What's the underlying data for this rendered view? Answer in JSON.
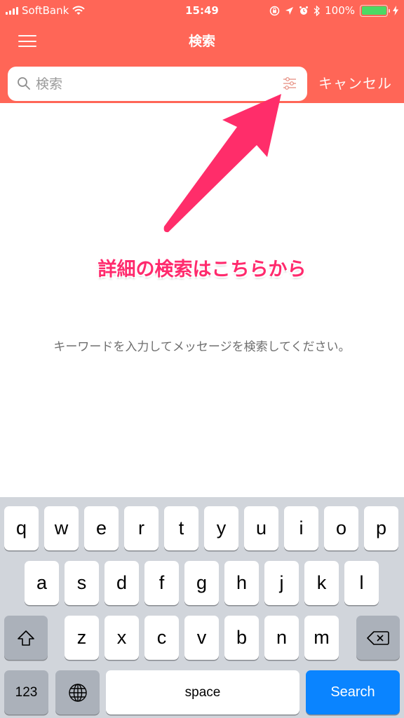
{
  "status_bar": {
    "carrier": "SoftBank",
    "time": "15:49",
    "battery_percent_text": "100%",
    "battery_level": 1.0,
    "icons": [
      "signal-icon",
      "wifi-icon",
      "rotation-lock-icon",
      "location-icon",
      "alarm-icon",
      "bluetooth-icon",
      "battery-icon",
      "charging-icon"
    ]
  },
  "nav": {
    "title": "検索",
    "menu_icon": "hamburger-menu-icon"
  },
  "search": {
    "placeholder": "検索",
    "value": "",
    "filter_icon": "filter-sliders-icon",
    "cancel_label": "キャンセル"
  },
  "annotation": {
    "text": "詳細の検索はこちらから",
    "color": "#ff2a6d"
  },
  "hint_text": "キーワードを入力してメッセージを検索してください。",
  "colors": {
    "header": "#ff6657",
    "keyboard_bg": "#d1d5db",
    "search_key": "#0a84ff"
  },
  "keyboard": {
    "row1": [
      "q",
      "w",
      "e",
      "r",
      "t",
      "y",
      "u",
      "i",
      "o",
      "p"
    ],
    "row2": [
      "a",
      "s",
      "d",
      "f",
      "g",
      "h",
      "j",
      "k",
      "l"
    ],
    "row3": [
      "z",
      "x",
      "c",
      "v",
      "b",
      "n",
      "m"
    ],
    "numbers_label": "123",
    "space_label": "space",
    "search_label": "Search"
  }
}
